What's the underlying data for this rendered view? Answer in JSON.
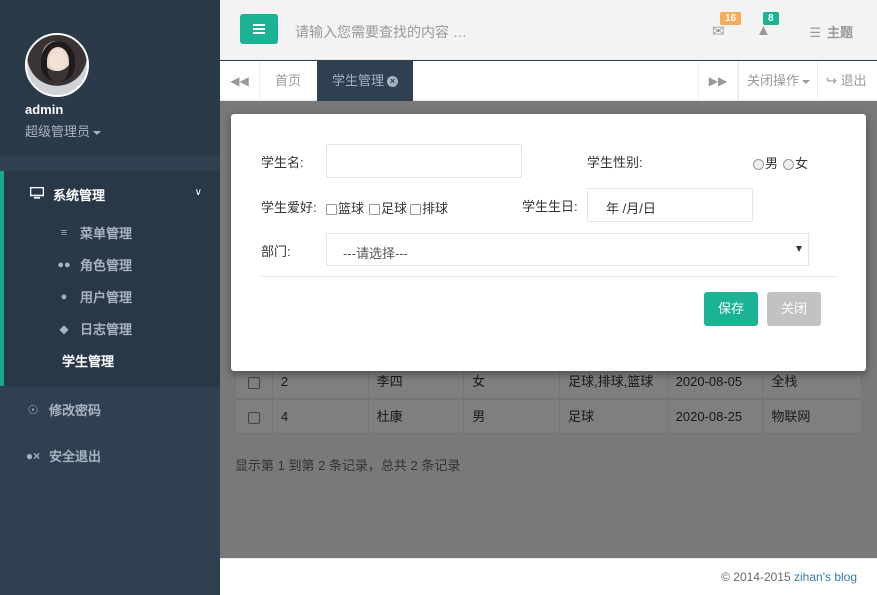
{
  "profile": {
    "name": "admin",
    "role": "超级管理员"
  },
  "sidebar": {
    "section": "系统管理",
    "subitems": [
      {
        "label": "菜单管理",
        "icon": "sliders-icon"
      },
      {
        "label": "角色管理",
        "icon": "users-icon"
      },
      {
        "label": "用户管理",
        "icon": "user-icon"
      },
      {
        "label": "日志管理",
        "icon": "tags-icon"
      },
      {
        "label": "学生管理",
        "icon": ""
      }
    ],
    "items": [
      {
        "label": "修改密码",
        "icon": "key-icon"
      },
      {
        "label": "安全退出",
        "icon": "user-times-icon"
      }
    ]
  },
  "topbar": {
    "search_placeholder": "请输入您需要查找的内容 …",
    "mail_count": "16",
    "bell_count": "8",
    "theme_label": "主题"
  },
  "tabs": {
    "home": "首页",
    "current": "学生管理",
    "close_ops": "关闭操作",
    "logout": "退出"
  },
  "form": {
    "name_label": "学生名:",
    "name_value": "",
    "gender_label": "学生性别:",
    "gender_male": "男",
    "gender_female": "女",
    "hobby_label": "学生爱好:",
    "hobbies": [
      "篮球",
      "足球",
      "排球"
    ],
    "birthday_label": "学生生日:",
    "birthday_placeholder": "年 /月/日",
    "dept_label": "部门:",
    "dept_value": "---请选择---",
    "save_label": "保存",
    "close_label": "关闭"
  },
  "table": {
    "rows": [
      [
        "2",
        "李四",
        "女",
        "足球,排球,篮球",
        "2020-08-05",
        "全栈"
      ],
      [
        "4",
        "杜康",
        "男",
        "足球",
        "2020-08-25",
        "物联网"
      ]
    ]
  },
  "pagination": {
    "summary": "显示第 1 到第 2 条记录，总共 2 条记录"
  },
  "footer": {
    "copyright": "© 2014-2015 ",
    "link": "zihan's blog"
  },
  "colors": {
    "accent": "#1ab394",
    "sidebar": "#2f4050",
    "badge_mail": "#f8ac59",
    "badge_bell": "#1ab394"
  }
}
